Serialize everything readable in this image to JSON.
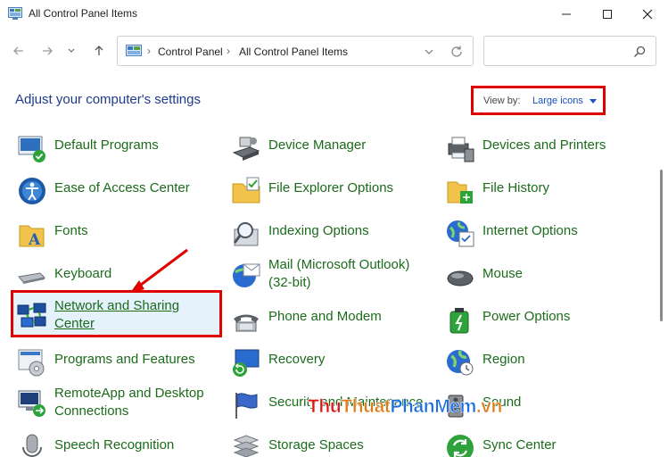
{
  "window": {
    "title": "All Control Panel Items",
    "minimize_icon": "minimize-icon",
    "maximize_icon": "maximize-icon",
    "close_icon": "close-icon"
  },
  "nav": {
    "breadcrumbs": [
      "Control Panel",
      "All Control Panel Items"
    ],
    "search_placeholder": "",
    "search_value": ""
  },
  "main": {
    "heading": "Adjust your computer's settings",
    "view_by_label": "View by:",
    "view_by_value": "Large icons"
  },
  "items": {
    "col1": [
      {
        "label": "Default Programs",
        "icon": "default-programs-icon"
      },
      {
        "label": "Ease of Access Center",
        "icon": "ease-of-access-icon"
      },
      {
        "label": "Fonts",
        "icon": "fonts-icon"
      },
      {
        "label": "Keyboard",
        "icon": "keyboard-icon"
      },
      {
        "label": "Network and Sharing",
        "label2": "Center",
        "icon": "network-sharing-icon"
      },
      {
        "label": "Programs and Features",
        "icon": "programs-features-icon"
      },
      {
        "label": "RemoteApp and Desktop",
        "label2": "Connections",
        "icon": "remoteapp-icon"
      },
      {
        "label": "Speech Recognition",
        "icon": "microphone-icon"
      }
    ],
    "col2": [
      {
        "label": "Device Manager",
        "icon": "device-manager-icon"
      },
      {
        "label": "File Explorer Options",
        "icon": "folder-options-icon"
      },
      {
        "label": "Indexing Options",
        "icon": "indexing-icon"
      },
      {
        "label": "Mail (Microsoft Outlook)",
        "label2": "(32-bit)",
        "icon": "mail-icon"
      },
      {
        "label": "Phone and Modem",
        "icon": "phone-icon"
      },
      {
        "label": "Recovery",
        "icon": "recovery-icon"
      },
      {
        "label": "Security and Maintenance",
        "icon": "flag-icon"
      },
      {
        "label": "Storage Spaces",
        "icon": "storage-icon"
      }
    ],
    "col3": [
      {
        "label": "Devices and Printers",
        "icon": "printer-icon"
      },
      {
        "label": "File History",
        "icon": "file-history-icon"
      },
      {
        "label": "Internet Options",
        "icon": "internet-options-icon"
      },
      {
        "label": "Mouse",
        "icon": "mouse-icon"
      },
      {
        "label": "Power Options",
        "icon": "power-icon"
      },
      {
        "label": "Region",
        "icon": "globe-icon"
      },
      {
        "label": "Sound",
        "icon": "speaker-icon"
      },
      {
        "label": "Sync Center",
        "icon": "sync-icon"
      }
    ]
  },
  "watermark": {
    "part1": "Thu",
    "part2": "Thuat",
    "part3": "PhanMem",
    "part4": ".vn"
  },
  "colors": {
    "link": "#1b6b1b",
    "heading": "#1e3a8a",
    "highlight": "#e10000",
    "accent": "#1a4fbf"
  }
}
